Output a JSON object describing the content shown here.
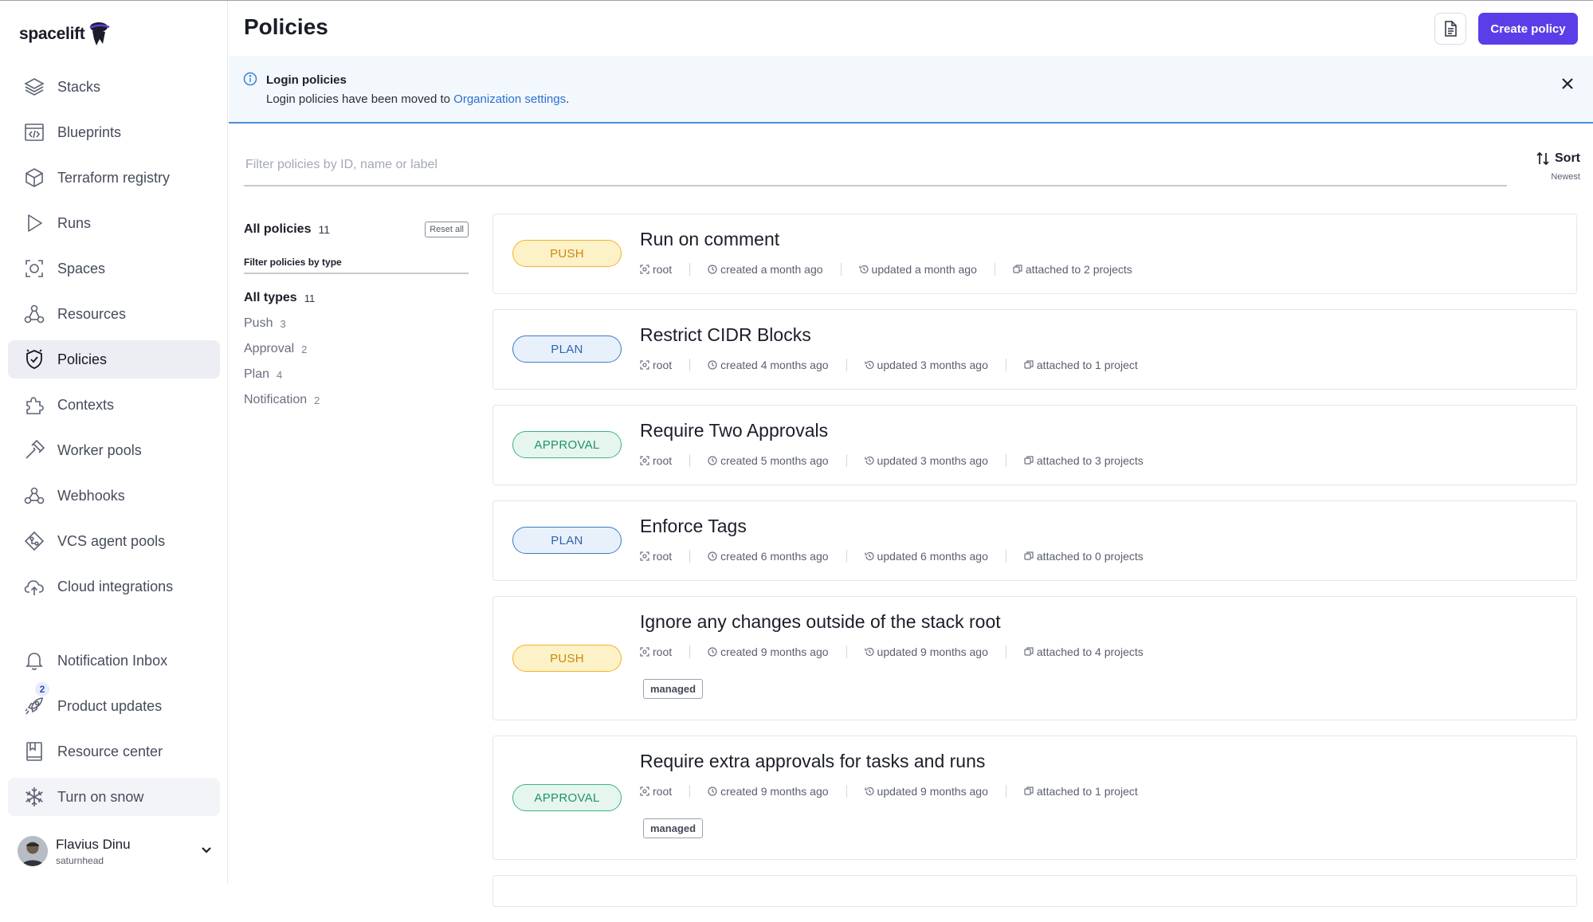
{
  "app": {
    "logo_text": "spacelift"
  },
  "sidebar": {
    "items": [
      {
        "label": "Stacks",
        "icon": "stacks-icon"
      },
      {
        "label": "Blueprints",
        "icon": "blueprints-icon"
      },
      {
        "label": "Terraform registry",
        "icon": "registry-icon"
      },
      {
        "label": "Runs",
        "icon": "runs-icon"
      },
      {
        "label": "Spaces",
        "icon": "spaces-icon"
      },
      {
        "label": "Resources",
        "icon": "resources-icon"
      },
      {
        "label": "Policies",
        "icon": "policies-icon",
        "active": true
      },
      {
        "label": "Contexts",
        "icon": "contexts-icon"
      },
      {
        "label": "Worker pools",
        "icon": "worker-pools-icon"
      },
      {
        "label": "Webhooks",
        "icon": "webhooks-icon"
      },
      {
        "label": "VCS agent pools",
        "icon": "vcs-agent-pools-icon"
      },
      {
        "label": "Cloud integrations",
        "icon": "cloud-integrations-icon"
      }
    ],
    "bottom_items": [
      {
        "label": "Notification Inbox",
        "icon": "bell-icon"
      },
      {
        "label": "Product updates",
        "icon": "rocket-icon",
        "badge": "2"
      },
      {
        "label": "Resource center",
        "icon": "book-icon"
      },
      {
        "label": "Turn on snow",
        "icon": "snowflake-icon"
      }
    ],
    "user": {
      "name": "Flavius Dinu",
      "handle": "saturnhead"
    }
  },
  "header": {
    "title": "Policies",
    "create_label": "Create policy"
  },
  "banner": {
    "title": "Login policies",
    "text": "Login policies have been moved to ",
    "link": "Organization settings",
    "suffix": "."
  },
  "filter": {
    "placeholder": "Filter policies by ID, name or label"
  },
  "sort": {
    "label": "Sort",
    "value": "Newest"
  },
  "filters": {
    "all_label": "All policies",
    "all_count": "11",
    "reset_label": "Reset all",
    "by_type_label": "Filter policies by type",
    "types": [
      {
        "name": "All types",
        "count": "11",
        "selected": true
      },
      {
        "name": "Push",
        "count": "3"
      },
      {
        "name": "Approval",
        "count": "2"
      },
      {
        "name": "Plan",
        "count": "4"
      },
      {
        "name": "Notification",
        "count": "2"
      }
    ]
  },
  "policies": [
    {
      "type": "PUSH",
      "kind": "push",
      "title": "Run on comment",
      "space": "root",
      "created": "created a month ago",
      "updated": "updated a month ago",
      "attached": "attached to 2 projects"
    },
    {
      "type": "PLAN",
      "kind": "plan",
      "title": "Restrict CIDR Blocks",
      "space": "root",
      "created": "created 4 months ago",
      "updated": "updated 3 months ago",
      "attached": "attached to 1 project"
    },
    {
      "type": "APPROVAL",
      "kind": "approval",
      "title": "Require Two Approvals",
      "space": "root",
      "created": "created 5 months ago",
      "updated": "updated 3 months ago",
      "attached": "attached to 3 projects"
    },
    {
      "type": "PLAN",
      "kind": "plan",
      "title": "Enforce Tags",
      "space": "root",
      "created": "created 6 months ago",
      "updated": "updated 6 months ago",
      "attached": "attached to 0 projects"
    },
    {
      "type": "PUSH",
      "kind": "push",
      "title": "Ignore any changes outside of the stack root",
      "space": "root",
      "created": "created 9 months ago",
      "updated": "updated 9 months ago",
      "attached": "attached to 4 projects",
      "label": "managed"
    },
    {
      "type": "APPROVAL",
      "kind": "approval",
      "title": "Require extra approvals for tasks and runs",
      "space": "root",
      "created": "created 9 months ago",
      "updated": "updated 9 months ago",
      "attached": "attached to 1 project",
      "label": "managed"
    }
  ]
}
